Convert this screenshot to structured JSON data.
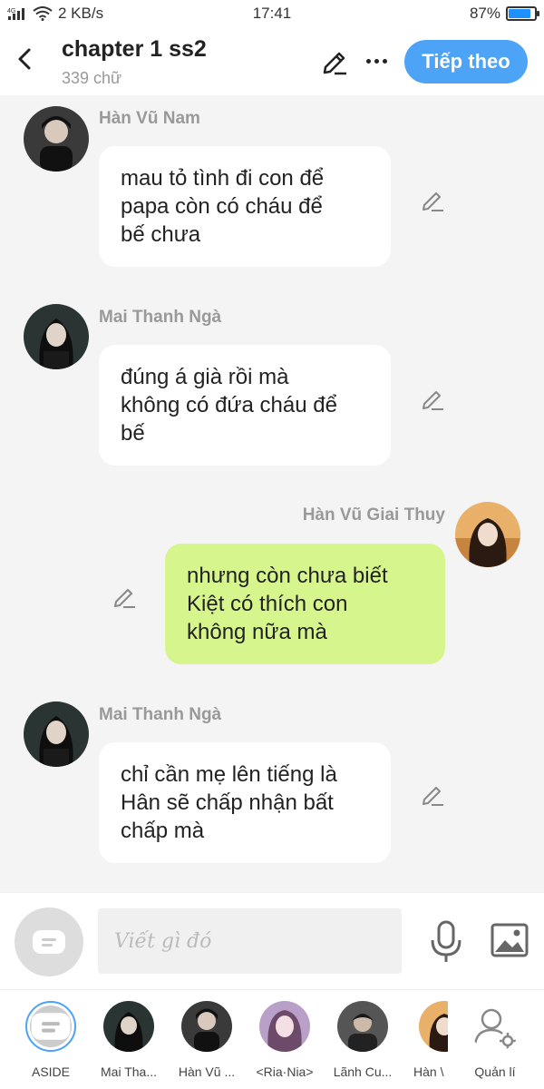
{
  "status_bar": {
    "network": "4G",
    "speed": "2 KB/s",
    "time": "17:41",
    "battery_percent": "87%",
    "battery_level": 0.87
  },
  "header": {
    "title": "chapter 1 ss2",
    "word_count": "339 chữ",
    "next_label": "Tiếp theo",
    "accent_color": "#4da3f5"
  },
  "messages": [
    {
      "sender": "Hàn Vũ Nam",
      "side": "left",
      "text_lines": [
        "mau tỏ tình đi con để",
        "papa còn có cháu để",
        "bế chưa"
      ]
    },
    {
      "sender": "Mai Thanh Ngà",
      "side": "left",
      "text_lines": [
        "đúng á già rồi mà",
        "không có đứa cháu để",
        "bế"
      ]
    },
    {
      "sender": "Hàn Vũ Giai Thuy",
      "side": "right",
      "text_lines": [
        "nhưng còn chưa biết",
        "Kiệt có thích con",
        "không nữa mà"
      ]
    },
    {
      "sender": "Mai Thanh Ngà",
      "side": "left",
      "text_lines": [
        "chỉ cần mẹ lên tiếng là",
        "Hân sẽ chấp nhận bất",
        "chấp mà"
      ]
    }
  ],
  "composer": {
    "placeholder": "Viết gì đó"
  },
  "characters": [
    {
      "name": "ASIDE"
    },
    {
      "name": "Mai Tha..."
    },
    {
      "name": "Hàn Vũ ..."
    },
    {
      "name": "<Ria·Nia>"
    },
    {
      "name": "Lãnh Cu..."
    },
    {
      "name": "Hàn \\"
    },
    {
      "name": "Quản lí"
    }
  ],
  "colors": {
    "my_bubble": "#d6f58c",
    "other_bubble": "#ffffff",
    "background": "#f4f4f4"
  }
}
